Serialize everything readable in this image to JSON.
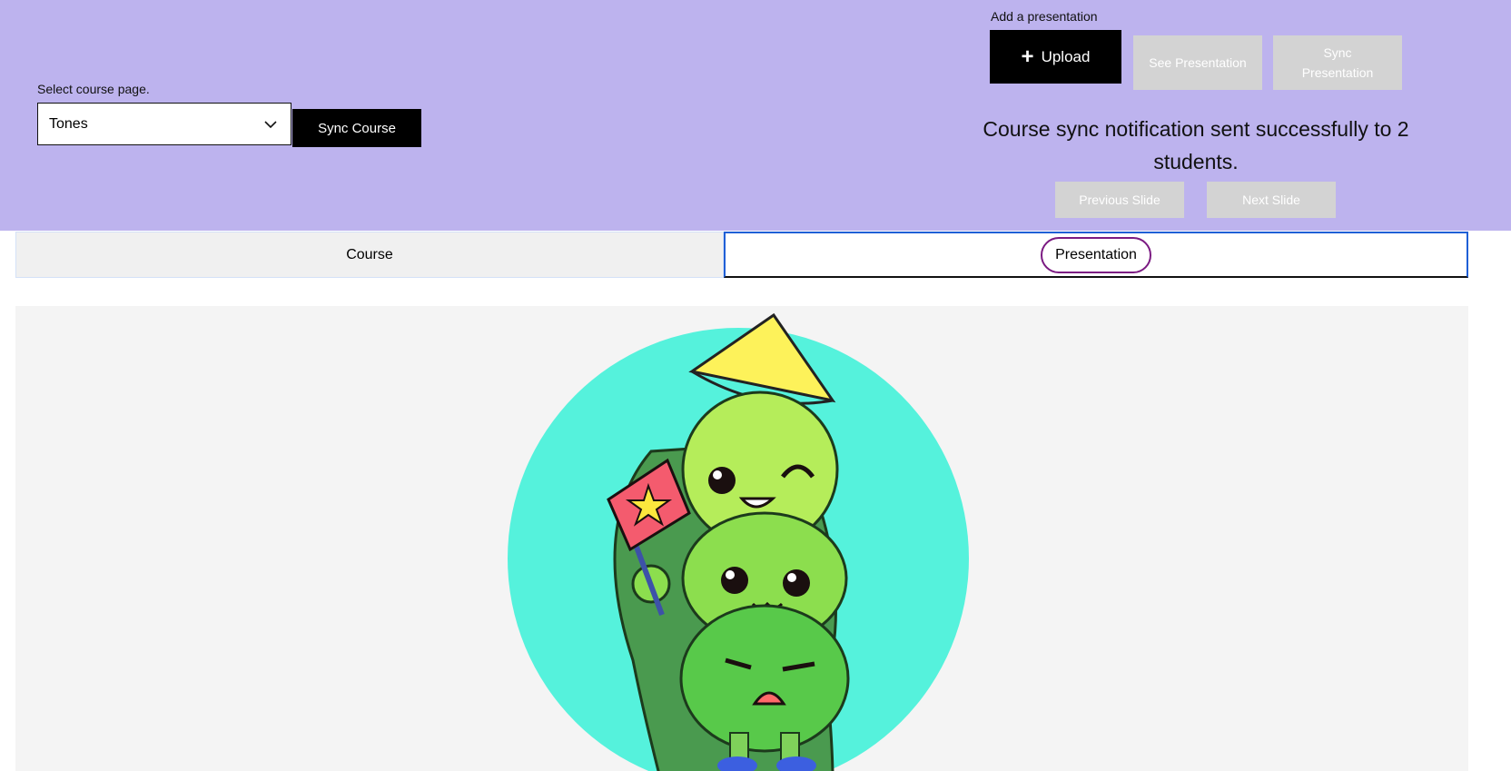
{
  "course_select": {
    "label": "Select course page.",
    "value": "Tones"
  },
  "sync_course_label": "Sync Course",
  "presentation": {
    "add_label": "Add a presentation",
    "upload_label": "Upload",
    "see_label": "See Presentation",
    "sync_label": "Sync Presentation"
  },
  "notification": "Course sync notification sent successfully to 2 students.",
  "slide_nav": {
    "prev_label": "Previous Slide",
    "next_label": "Next Slide"
  },
  "tabs": [
    {
      "label": "Course",
      "selected": false
    },
    {
      "label": "Presentation",
      "selected": true
    }
  ],
  "slide_image": {
    "description_icon": "pea-pod-mascot-illustration"
  },
  "colors": {
    "header_bg": "#bdb3ee",
    "primary_button": "#000000",
    "disabled_button": "#d3d3d3",
    "active_tab_border": "#1f5fd6",
    "highlight_ring": "#7b1a82",
    "slide_circle": "#55f2dc"
  }
}
